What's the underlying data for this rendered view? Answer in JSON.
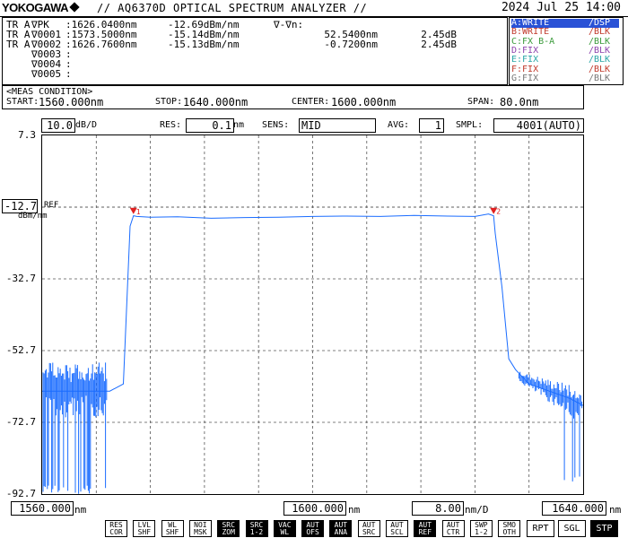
{
  "header": {
    "brand": "YOKOGAWA",
    "title": "// AQ6370D OPTICAL SPECTRUM ANALYZER //",
    "datetime": "2024 Jul 25 14:00"
  },
  "trace_table": {
    "rows": [
      {
        "col1": "TR A",
        "col2": "∇PK",
        "col3": ":1626.0400nm",
        "col4": "-12.69dBm/nm",
        "col5": "∇-∇n:",
        "col6": "",
        "col7": ""
      },
      {
        "col1": "TR A",
        "col2": "∇0001",
        "col3": ":1573.5000nm",
        "col4": "-15.14dBm/nm",
        "col5": "",
        "col6": "52.5400nm",
        "col7": "2.45dB"
      },
      {
        "col1": "TR A",
        "col2": "∇0002",
        "col3": ":1626.7600nm",
        "col4": "-15.13dBm/nm",
        "col5": "",
        "col6": "-0.7200nm",
        "col7": "2.45dB"
      },
      {
        "col1": "",
        "col2": "∇0003",
        "col3": ":",
        "col4": "",
        "col5": "",
        "col6": "",
        "col7": ""
      },
      {
        "col1": "",
        "col2": "∇0004",
        "col3": ":",
        "col4": "",
        "col5": "",
        "col6": "",
        "col7": ""
      },
      {
        "col1": "",
        "col2": "∇0005",
        "col3": ":",
        "col4": "",
        "col5": "",
        "col6": "",
        "col7": ""
      }
    ]
  },
  "trace_modes": [
    {
      "name": "A:WRITE",
      "disp": "/DSP",
      "color": "#1a6cff",
      "selected": true
    },
    {
      "name": "B:WRITE",
      "disp": "/BLK",
      "color": "#c0392b",
      "selected": false
    },
    {
      "name": "C:FX B-A",
      "disp": "/BLK",
      "color": "#3a9a3a",
      "selected": false
    },
    {
      "name": "D:FIX",
      "disp": "/BLK",
      "color": "#8e44ad",
      "selected": false
    },
    {
      "name": "E:FIX",
      "disp": "/BLK",
      "color": "#2aa6a6",
      "selected": false
    },
    {
      "name": "F:FIX",
      "disp": "/BLK",
      "color": "#c0392b",
      "selected": false
    },
    {
      "name": "G:FIX",
      "disp": "/BLK",
      "color": "#777777",
      "selected": false
    }
  ],
  "meas": {
    "title": "<MEAS CONDITION>",
    "start_label": "START:",
    "start_value": "1560.000nm",
    "stop_label": "STOP:",
    "stop_value": "1640.000nm",
    "center_label": "CENTER:",
    "center_value": "1600.000nm",
    "span_label": "SPAN:",
    "span_value": "80.0nm"
  },
  "params": {
    "scale_value": "10.0",
    "scale_unit": "dB/D",
    "res_label": "RES:",
    "res_value": "0.1",
    "res_unit": "nm",
    "sens_label": "SENS:",
    "sens_value": "MID",
    "avg_label": "AVG:",
    "avg_value": "1",
    "smpl_label": "SMPL:",
    "smpl_value": "4001(AUTO)"
  },
  "graph": {
    "ref_value": "-12.7",
    "ref_label": "REF",
    "ref_unit": "dBm/nm",
    "y_labels": [
      "7.3",
      "-32.7",
      "-52.7",
      "-72.7",
      "-92.7"
    ],
    "x_start": "1560.000",
    "x_start_unit": "nm",
    "x_center": "1600.000",
    "x_center_unit": "nm",
    "x_scale": "8.00",
    "x_scale_unit": "nm/D",
    "x_stop": "1640.000",
    "x_stop_unit": "nm",
    "marker1_label": "1",
    "marker2_label": "2",
    "trace_color": "#1a6cff",
    "marker_color": "#e02020"
  },
  "chart_data": {
    "type": "line",
    "xlabel": "",
    "ylabel": "",
    "xlim": [
      1560,
      1640
    ],
    "ylim": [
      -92.7,
      7.3
    ],
    "series": [
      {
        "x": [
          1560,
          1563,
          1566,
          1569,
          1570,
          1572,
          1573,
          1573.5,
          1574,
          1576,
          1580,
          1585,
          1590,
          1595,
          1600,
          1605,
          1610,
          1615,
          1620,
          1624,
          1626,
          1626.76,
          1627,
          1628,
          1629,
          1630,
          1632,
          1635,
          1638,
          1640
        ],
        "y": [
          -64,
          -64,
          -64,
          -64,
          -64,
          -62,
          -18,
          -15.1,
          -15.3,
          -15.5,
          -15.4,
          -15.8,
          -15.6,
          -15.5,
          -15.3,
          -15.2,
          -15.3,
          -15.0,
          -15.2,
          -15.3,
          -14.6,
          -15.1,
          -20,
          -35,
          -55,
          -58,
          -62,
          -64,
          -66,
          -68
        ]
      }
    ]
  },
  "softkeys": [
    {
      "line1": "RES",
      "line2": "COR",
      "on": false
    },
    {
      "line1": "LVL",
      "line2": "SHF",
      "on": false
    },
    {
      "line1": "WL",
      "line2": "SHF",
      "on": false
    },
    {
      "line1": "NOI",
      "line2": "MSK",
      "on": false
    },
    {
      "line1": "SRC",
      "line2": "ZOM",
      "on": true
    },
    {
      "line1": "SRC",
      "line2": "1-2",
      "on": true
    },
    {
      "line1": "VAC",
      "line2": "WL",
      "on": true
    },
    {
      "line1": "AUT",
      "line2": "OFS",
      "on": true
    },
    {
      "line1": "AUT",
      "line2": "ANA",
      "on": true
    },
    {
      "line1": "AUT",
      "line2": "SRC",
      "on": false
    },
    {
      "line1": "AUT",
      "line2": "SCL",
      "on": false
    },
    {
      "line1": "AUT",
      "line2": "REF",
      "on": true
    },
    {
      "line1": "AUT",
      "line2": "CTR",
      "on": false
    },
    {
      "line1": "SWP",
      "line2": "1-2",
      "on": false
    },
    {
      "line1": "SMO",
      "line2": "OTH",
      "on": false
    }
  ],
  "bigkeys": [
    {
      "label": "RPT",
      "on": false
    },
    {
      "label": "SGL",
      "on": false
    },
    {
      "label": "STP",
      "on": true
    }
  ]
}
